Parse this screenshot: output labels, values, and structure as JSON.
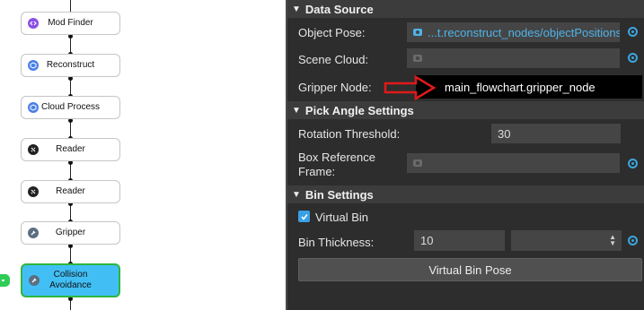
{
  "flowchart": {
    "nodes": [
      {
        "label": "Mod Finder",
        "icon": "mod-finder-icon",
        "icon_color": "#8a4fe6"
      },
      {
        "label": "Reconstruct",
        "icon": "reconstruct-icon",
        "icon_color": "#4a7fe8"
      },
      {
        "label": "Cloud Process",
        "icon": "cloud-process-icon",
        "icon_color": "#4a7fe8"
      },
      {
        "label": "Reader",
        "icon": "reader-icon",
        "icon_color": "#222222"
      },
      {
        "label": "Reader",
        "icon": "reader-icon",
        "icon_color": "#222222"
      },
      {
        "label": "Gripper",
        "icon": "gripper-icon",
        "icon_color": "#5b6f82"
      },
      {
        "label": "Collision Avoidance",
        "icon": "collision-avoidance-icon",
        "icon_color": "#5b6f82",
        "active": true
      }
    ],
    "active_color": "#41bff5",
    "active_border": "#2fb53f"
  },
  "panel": {
    "data_source": {
      "title": "Data Source",
      "object_pose_label": "Object Pose:",
      "object_pose_value": "...t.reconstruct_nodes/objectPositions",
      "scene_cloud_label": "Scene Cloud:",
      "scene_cloud_value": "",
      "gripper_node_label": "Gripper Node:",
      "gripper_node_value": "main_flowchart.gripper_node"
    },
    "pick_angle": {
      "title": "Pick Angle Settings",
      "rotation_threshold_label": "Rotation Threshold:",
      "rotation_threshold_value": "30",
      "box_reference_label_1": "Box Reference",
      "box_reference_label_2": "Frame:",
      "box_reference_value": ""
    },
    "bin_settings": {
      "title": "Bin Settings",
      "virtual_bin_label": "Virtual Bin",
      "virtual_bin_checked": true,
      "bin_thickness_label": "Bin Thickness:",
      "bin_thickness_value": "10",
      "bin_thickness_unit": "",
      "virtual_bin_pose_button": "Virtual Bin Pose"
    }
  },
  "colors": {
    "panel_bg": "#2d2d2d",
    "section_header_bg": "#3c3c3c",
    "field_bg": "#454545",
    "accent_blue": "#3ba6e0",
    "annotation_red": "#e01919"
  }
}
